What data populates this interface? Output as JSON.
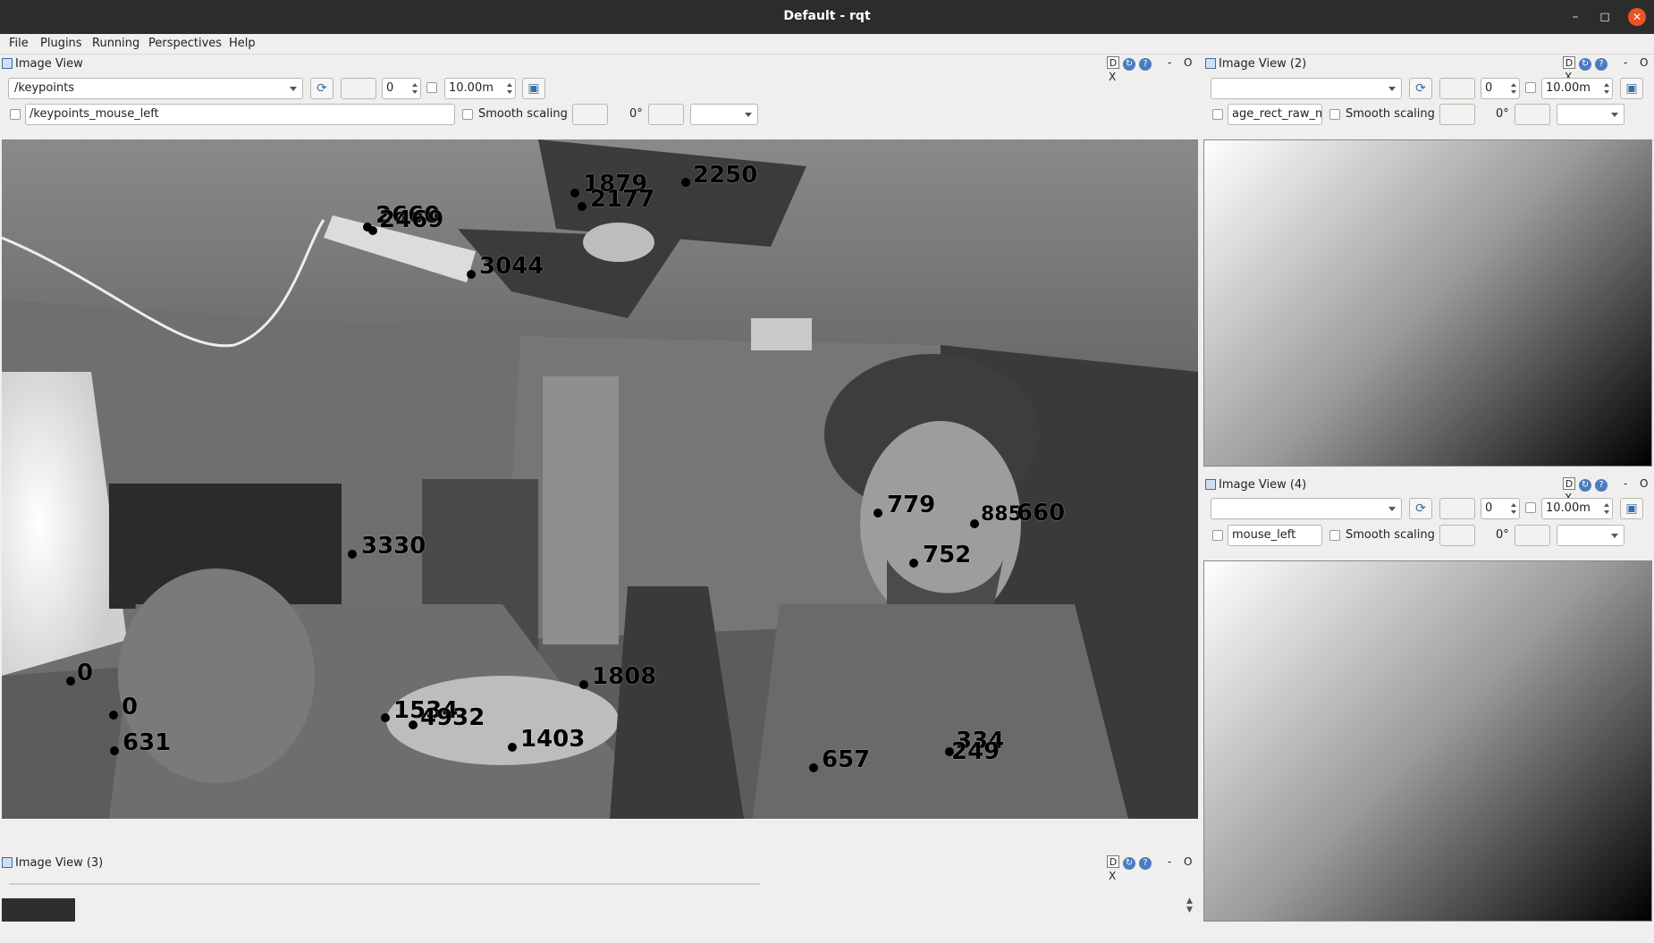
{
  "window": {
    "title": "Default - rqt",
    "minimize": "–",
    "maximize": "◻",
    "close": "✕"
  },
  "menu": [
    "File",
    "Plugins",
    "Running",
    "Perspectives",
    "Help"
  ],
  "dock_controls": {
    "d": "D",
    "min": "-",
    "float": "O",
    "close": "X"
  },
  "main_view": {
    "title": "Image View",
    "topic": "/keypoints",
    "spin_value": "0",
    "max_range": "10.00m",
    "publish_topic": "/keypoints_mouse_left",
    "smooth_scaling": "Smooth scaling",
    "rotation": "0°"
  },
  "view2": {
    "title": "Image View (2)",
    "topic": "",
    "spin_value": "0",
    "max_range": "10.00m",
    "publish_topic": "age_rect_raw_mo",
    "smooth_scaling": "Smooth scaling",
    "rotation": "0°"
  },
  "view4": {
    "title": "Image View (4)",
    "topic": "",
    "spin_value": "0",
    "max_range": "10.00m",
    "publish_topic": "mouse_left",
    "smooth_scaling": "Smooth scaling",
    "rotation": "0°"
  },
  "view3": {
    "title": "Image View (3)"
  },
  "keypoints": [
    "1879",
    "2177",
    "2250",
    "2660",
    "2469",
    "3044",
    "3330",
    "779",
    "885",
    "660",
    "752",
    "0",
    "0",
    "631",
    "1808",
    "1534",
    "4932",
    "1403",
    "657",
    "334",
    "249"
  ],
  "colors": {
    "accent": "#e95420",
    "titlebar": "#2c2c2c",
    "icon_blue": "#3b6ea8"
  }
}
